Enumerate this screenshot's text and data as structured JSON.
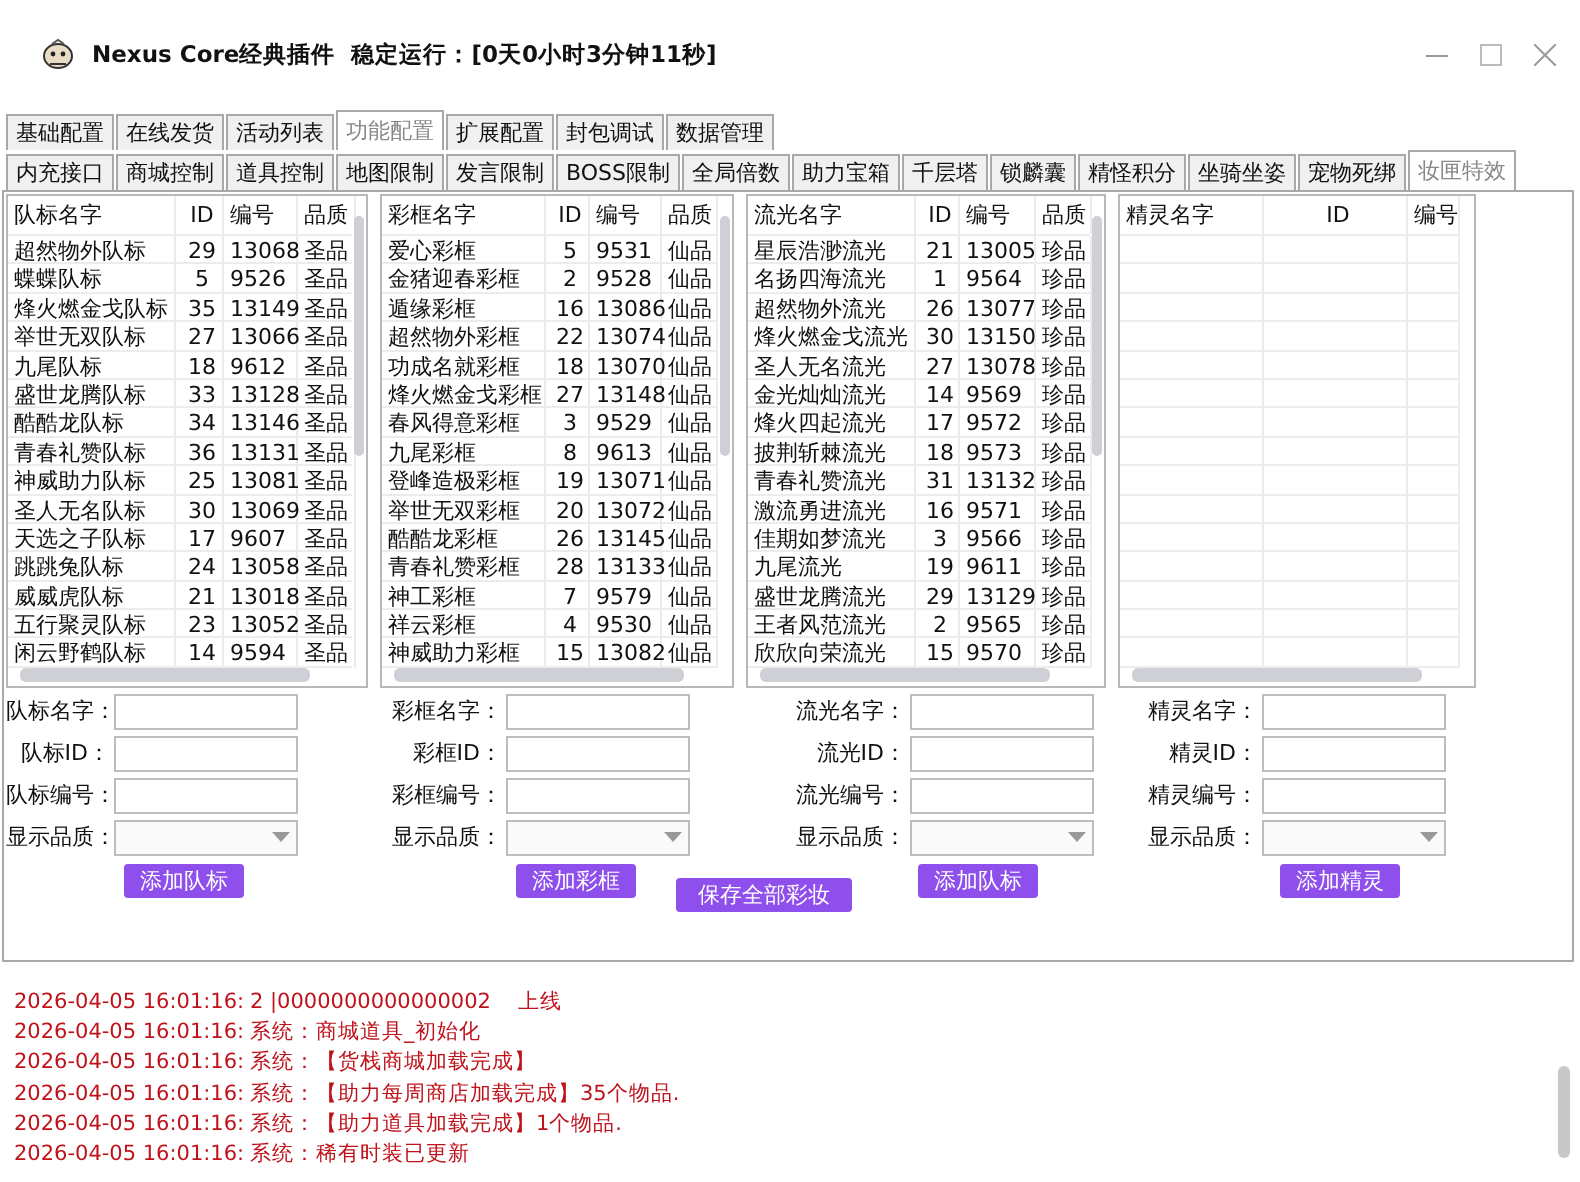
{
  "window": {
    "title": "Nexus Core经典插件",
    "uptime": "稳定运行：[0天0小时3分钟11秒]"
  },
  "main_tabs": [
    {
      "label": "基础配置",
      "selected": false
    },
    {
      "label": "在线发货",
      "selected": false
    },
    {
      "label": "活动列表",
      "selected": false
    },
    {
      "label": "功能配置",
      "selected": true
    },
    {
      "label": "扩展配置",
      "selected": false
    },
    {
      "label": "封包调试",
      "selected": false
    },
    {
      "label": "数据管理",
      "selected": false
    }
  ],
  "sub_tabs": [
    {
      "label": "内充接口",
      "selected": false
    },
    {
      "label": "商城控制",
      "selected": false
    },
    {
      "label": "道具控制",
      "selected": false
    },
    {
      "label": "地图限制",
      "selected": false
    },
    {
      "label": "发言限制",
      "selected": false
    },
    {
      "label": "BOSS限制",
      "selected": false
    },
    {
      "label": "全局倍数",
      "selected": false
    },
    {
      "label": "助力宝箱",
      "selected": false
    },
    {
      "label": "千层塔",
      "selected": false
    },
    {
      "label": "锁麟囊",
      "selected": false
    },
    {
      "label": "精怪积分",
      "selected": false
    },
    {
      "label": "坐骑坐姿",
      "selected": false
    },
    {
      "label": "宠物死绑",
      "selected": false
    },
    {
      "label": "妆匣特效",
      "selected": true
    }
  ],
  "tables": [
    {
      "columns": [
        "队标名字",
        "ID",
        "编号",
        "品质"
      ],
      "rows": [
        [
          "超然物外队标",
          "29",
          "13068",
          "圣品"
        ],
        [
          "蝶蝶队标",
          "5",
          "9526",
          "圣品"
        ],
        [
          "烽火燃金戈队标",
          "35",
          "13149",
          "圣品"
        ],
        [
          "举世无双队标",
          "27",
          "13066",
          "圣品"
        ],
        [
          "九尾队标",
          "18",
          "9612",
          "圣品"
        ],
        [
          "盛世龙腾队标",
          "33",
          "13128",
          "圣品"
        ],
        [
          "酷酷龙队标",
          "34",
          "13146",
          "圣品"
        ],
        [
          "青春礼赞队标",
          "36",
          "13131",
          "圣品"
        ],
        [
          "神威助力队标",
          "25",
          "13081",
          "圣品"
        ],
        [
          "圣人无名队标",
          "30",
          "13069",
          "圣品"
        ],
        [
          "天选之子队标",
          "17",
          "9607",
          "圣品"
        ],
        [
          "跳跳兔队标",
          "24",
          "13058",
          "圣品"
        ],
        [
          "威威虎队标",
          "21",
          "13018",
          "圣品"
        ],
        [
          "五行聚灵队标",
          "23",
          "13052",
          "圣品"
        ],
        [
          "闲云野鹤队标",
          "14",
          "9594",
          "圣品"
        ]
      ]
    },
    {
      "columns": [
        "彩框名字",
        "ID",
        "编号",
        "品质"
      ],
      "rows": [
        [
          "爱心彩框",
          "5",
          "9531",
          "仙品"
        ],
        [
          "金猪迎春彩框",
          "2",
          "9528",
          "仙品"
        ],
        [
          "遁缘彩框",
          "16",
          "13086",
          "仙品"
        ],
        [
          "超然物外彩框",
          "22",
          "13074",
          "仙品"
        ],
        [
          "功成名就彩框",
          "18",
          "13070",
          "仙品"
        ],
        [
          "烽火燃金戈彩框",
          "27",
          "13148",
          "仙品"
        ],
        [
          "春风得意彩框",
          "3",
          "9529",
          "仙品"
        ],
        [
          "九尾彩框",
          "8",
          "9613",
          "仙品"
        ],
        [
          "登峰造极彩框",
          "19",
          "13071",
          "仙品"
        ],
        [
          "举世无双彩框",
          "20",
          "13072",
          "仙品"
        ],
        [
          "酷酷龙彩框",
          "26",
          "13145",
          "仙品"
        ],
        [
          "青春礼赞彩框",
          "28",
          "13133",
          "仙品"
        ],
        [
          "神工彩框",
          "7",
          "9579",
          "仙品"
        ],
        [
          "祥云彩框",
          "4",
          "9530",
          "仙品"
        ],
        [
          "神威助力彩框",
          "15",
          "13082",
          "仙品"
        ]
      ]
    },
    {
      "columns": [
        "流光名字",
        "ID",
        "编号",
        "品质"
      ],
      "rows": [
        [
          "星辰浩渺流光",
          "21",
          "13005",
          "珍品"
        ],
        [
          "名扬四海流光",
          "1",
          "9564",
          "珍品"
        ],
        [
          "超然物外流光",
          "26",
          "13077",
          "珍品"
        ],
        [
          "烽火燃金戈流光",
          "30",
          "13150",
          "珍品"
        ],
        [
          "圣人无名流光",
          "27",
          "13078",
          "珍品"
        ],
        [
          "金光灿灿流光",
          "14",
          "9569",
          "珍品"
        ],
        [
          "烽火四起流光",
          "17",
          "9572",
          "珍品"
        ],
        [
          "披荆斩棘流光",
          "18",
          "9573",
          "珍品"
        ],
        [
          "青春礼赞流光",
          "31",
          "13132",
          "珍品"
        ],
        [
          "激流勇进流光",
          "16",
          "9571",
          "珍品"
        ],
        [
          "佳期如梦流光",
          "3",
          "9566",
          "珍品"
        ],
        [
          "九尾流光",
          "19",
          "9611",
          "珍品"
        ],
        [
          "盛世龙腾流光",
          "29",
          "13129",
          "珍品"
        ],
        [
          "王者风范流光",
          "2",
          "9565",
          "珍品"
        ],
        [
          "欣欣向荣流光",
          "15",
          "9570",
          "珍品"
        ]
      ]
    },
    {
      "columns": [
        "精灵名字",
        "ID",
        "编号"
      ]
    }
  ],
  "forms": [
    {
      "fields": [
        {
          "label": "队标名字：",
          "kind": "text"
        },
        {
          "label": "队标ID：",
          "kind": "text"
        },
        {
          "label": "队标编号：",
          "kind": "text"
        },
        {
          "label": "显示品质：",
          "kind": "select"
        }
      ],
      "add_button": "添加队标"
    },
    {
      "fields": [
        {
          "label": "彩框名字：",
          "kind": "text"
        },
        {
          "label": "彩框ID：",
          "kind": "text"
        },
        {
          "label": "彩框编号：",
          "kind": "text"
        },
        {
          "label": "显示品质：",
          "kind": "select"
        }
      ],
      "add_button": "添加彩框"
    },
    {
      "fields": [
        {
          "label": "流光名字：",
          "kind": "text"
        },
        {
          "label": "流光ID：",
          "kind": "text"
        },
        {
          "label": "流光编号：",
          "kind": "text"
        },
        {
          "label": "显示品质：",
          "kind": "select"
        }
      ],
      "add_button": "添加队标"
    },
    {
      "fields": [
        {
          "label": "精灵名字：",
          "kind": "text"
        },
        {
          "label": "精灵ID：",
          "kind": "text"
        },
        {
          "label": "精灵编号：",
          "kind": "text"
        },
        {
          "label": "显示品质：",
          "kind": "select"
        }
      ],
      "add_button": "添加精灵"
    }
  ],
  "save_button": "保存全部彩妆",
  "log": [
    {
      "time": "2026-04-05 16:01:16:",
      "message": "2 |0000000000000002    上线"
    },
    {
      "time": "2026-04-05 16:01:16:",
      "message": "系统：商城道具_初始化"
    },
    {
      "time": "2026-04-05 16:01:16:",
      "message": "系统：【货栈商城加载完成】"
    },
    {
      "time": "2026-04-05 16:01:16:",
      "message": "系统：【助力每周商店加载完成】35个物品."
    },
    {
      "time": "2026-04-05 16:01:16:",
      "message": "系统：【助力道具加载完成】1个物品."
    },
    {
      "time": "2026-04-05 16:01:16:",
      "message": "系统：稀有时装已更新"
    }
  ]
}
